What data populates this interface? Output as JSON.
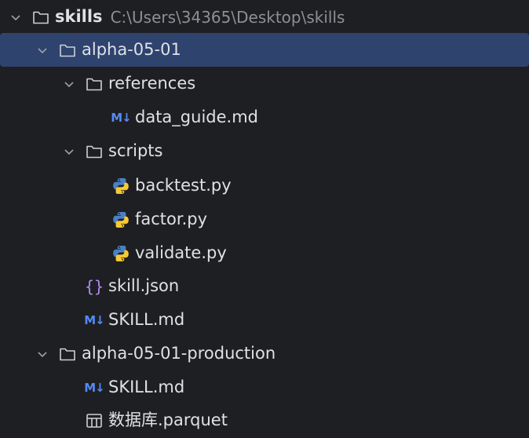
{
  "tree": {
    "root": {
      "label": "skills",
      "path": "C:\\Users\\34365\\Desktop\\skills"
    },
    "alpha_folder": {
      "label": "alpha-05-01"
    },
    "references_folder": {
      "label": "references"
    },
    "data_guide": {
      "label": "data_guide.md"
    },
    "scripts_folder": {
      "label": "scripts"
    },
    "backtest": {
      "label": "backtest.py"
    },
    "factor": {
      "label": "factor.py"
    },
    "validate": {
      "label": "validate.py"
    },
    "skill_json": {
      "label": "skill.json"
    },
    "skill_md": {
      "label": "SKILL.md"
    },
    "production_folder": {
      "label": "alpha-05-01-production"
    },
    "production_skill_md": {
      "label": "SKILL.md"
    },
    "parquet": {
      "label": "数据库.parquet"
    }
  },
  "icons": {
    "folder": "folder-icon",
    "chevron": "chevron-down-icon",
    "markdown": "markdown-icon",
    "python": "python-icon",
    "json": "json-icon",
    "table": "table-icon"
  },
  "colors": {
    "background": "#1e1f22",
    "selection": "#2e436e",
    "text": "#dfe1e5",
    "path": "#8c8f96",
    "markdown": "#548af7",
    "json": "#b189f5"
  }
}
